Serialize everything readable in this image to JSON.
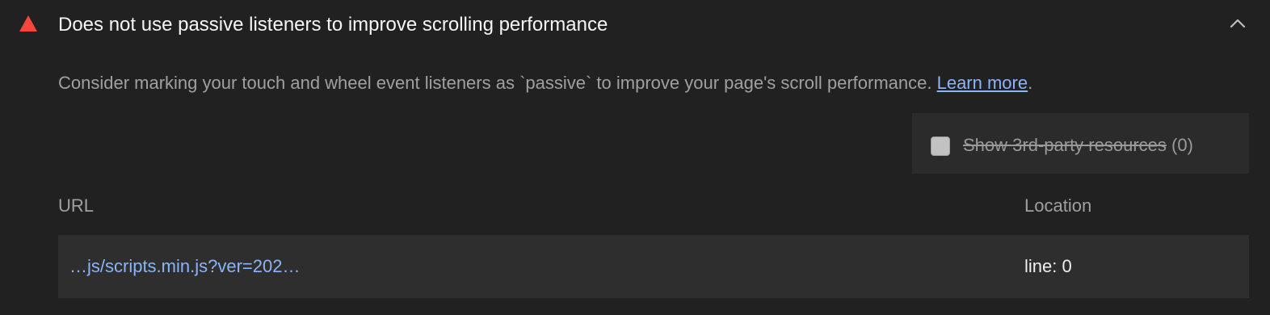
{
  "audit": {
    "status_icon": "warning-triangle-icon",
    "title": "Does not use passive listeners to improve scrolling performance",
    "collapse_icon": "chevron-up-icon",
    "description": "Consider marking your touch and wheel event listeners as `passive` to improve your page's scroll performance. ",
    "learn_more": "Learn more",
    "description_end": ".",
    "colors": {
      "warning": "#f4473a",
      "link": "#8ab4f8",
      "background": "#212121"
    }
  },
  "third_party_filter": {
    "label": "Show 3rd-party resources",
    "count": "(0)",
    "checked": false
  },
  "table": {
    "columns": [
      "URL",
      "Location"
    ],
    "rows": [
      {
        "url": "…js/scripts.min.js?ver=202…",
        "location": "line: 0"
      }
    ]
  }
}
